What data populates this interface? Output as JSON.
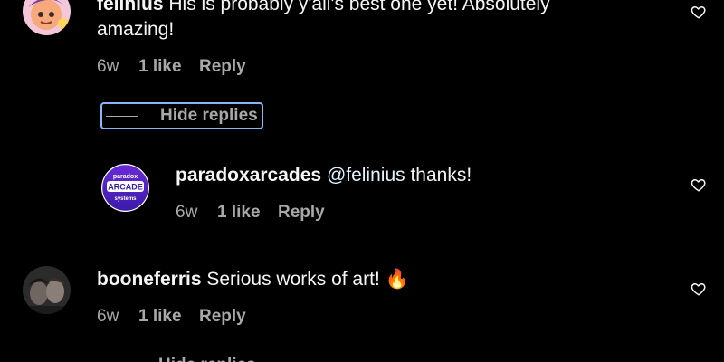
{
  "comments": [
    {
      "username": "felinius",
      "text_line1": "His is probably y'all's best one yet! Absolutely",
      "text_line2": "amazing!",
      "age": "6w",
      "likes": "1 like",
      "reply": "Reply",
      "avatar_icon": "cartoon-avatar-icon"
    },
    {
      "username": "paradoxarcades",
      "mention": "@felinius",
      "text": "thanks!",
      "age": "6w",
      "likes": "1 like",
      "reply": "Reply",
      "avatar_logo_lines": [
        "paradox",
        "ARCADE",
        "systems"
      ],
      "avatar_icon": "paradox-arcade-logo"
    },
    {
      "username": "booneferris",
      "text": "Serious works of art! 🔥",
      "age": "6w",
      "likes": "1 like",
      "reply": "Reply",
      "avatar_icon": "photo-avatar-icon"
    }
  ],
  "replies_toggle": {
    "label": "Hide replies"
  },
  "replies_toggle_cut": {
    "label": "Hide replies"
  },
  "colors": {
    "background": "#000000",
    "text": "#f5f5f5",
    "secondary": "#a8a8a8",
    "focus_ring": "#8ab4f8",
    "mention": "#e0f1ff"
  }
}
